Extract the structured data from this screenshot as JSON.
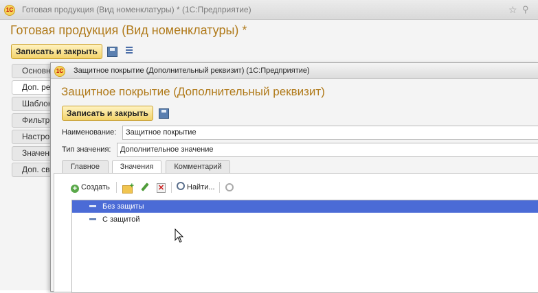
{
  "back_window": {
    "title": "Готовая продукция (Вид номенклатуры) * (1С:Предприятие)",
    "heading": "Готовая продукция (Вид номенклатуры) *",
    "save_close_label": "Записать и закрыть",
    "side_tabs": [
      "Основные",
      "Доп. реквизиты",
      "Шаблоны",
      "Фильтр",
      "Настройки",
      "Значения",
      "Доп. сведения"
    ]
  },
  "front_window": {
    "title": "Защитное покрытие (Дополнительный реквизит) (1С:Предприятие)",
    "heading": "Защитное покрытие (Дополнительный реквизит)",
    "save_close_label": "Записать и закрыть",
    "name_label": "Наименование:",
    "name_value": "Защитное покрытие",
    "type_label": "Тип значения:",
    "type_value": "Дополнительное значение",
    "tabs": [
      "Главное",
      "Значения",
      "Комментарий"
    ],
    "active_tab": "Значения",
    "toolbar": {
      "create_label": "Создать",
      "find_label": "Найти..."
    },
    "values": [
      {
        "label": "Без защиты",
        "selected": true
      },
      {
        "label": "С защитой",
        "selected": false
      }
    ]
  },
  "colors": {
    "heading": "#b07a1a",
    "selection": "#4b6bd6",
    "button": "#f3d36a"
  }
}
